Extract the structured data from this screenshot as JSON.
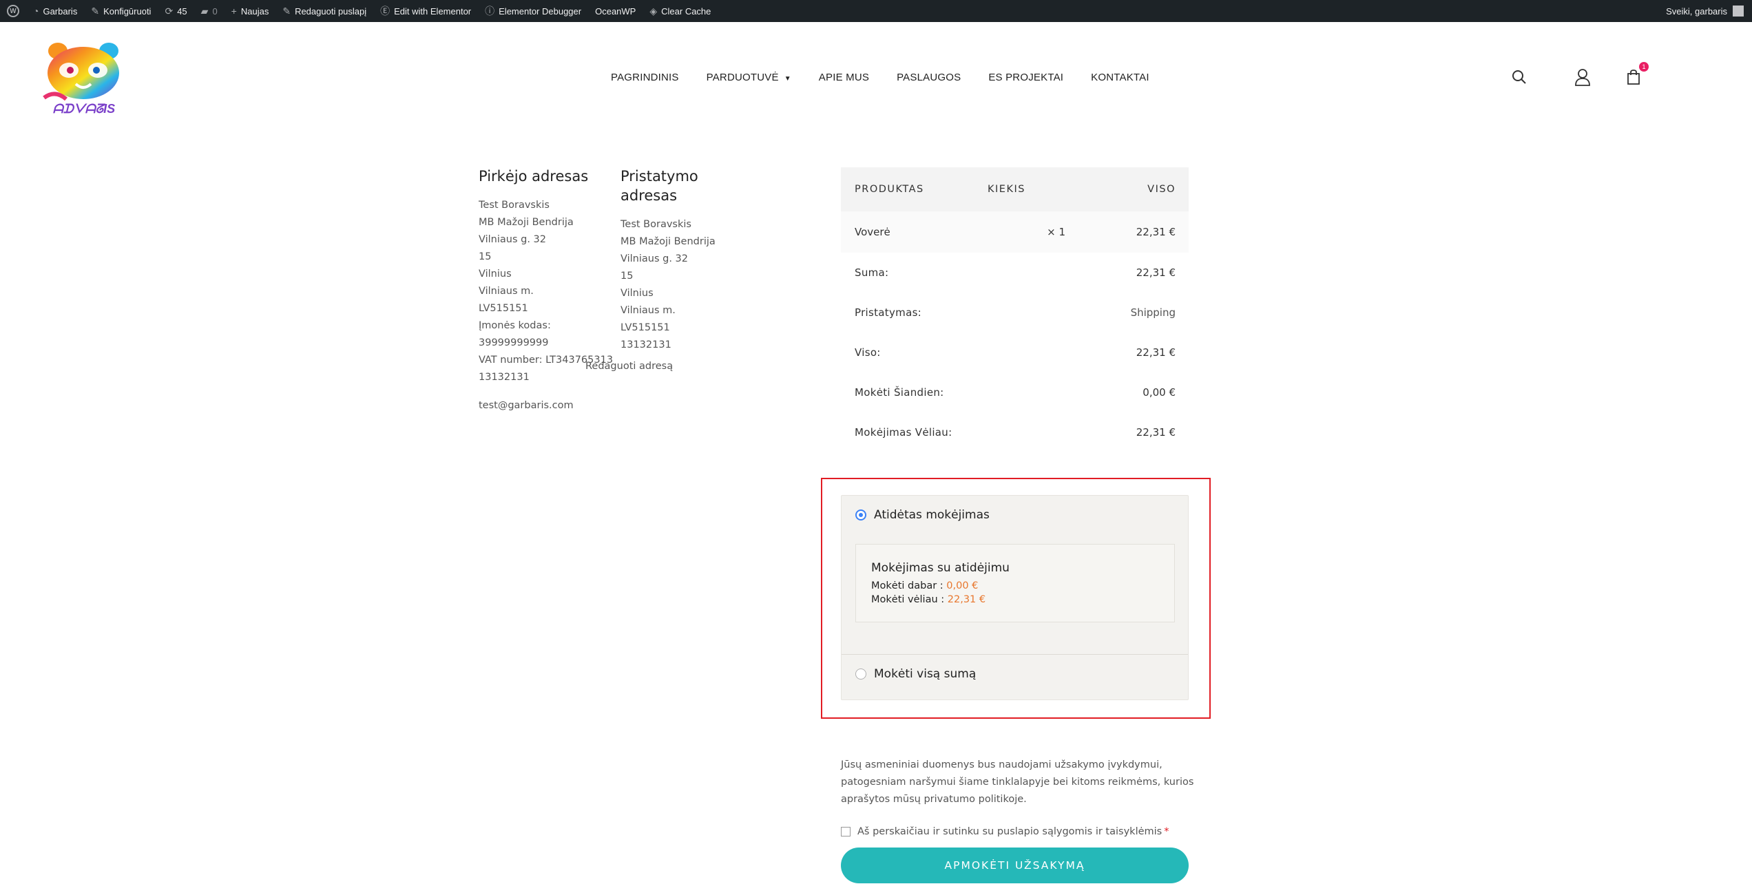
{
  "adminbar": {
    "site": "Garbaris",
    "customize": "Konfigūruoti",
    "updates": "45",
    "comments": "0",
    "new": "Naujas",
    "edit_page": "Redaguoti puslapį",
    "elementor": "Edit with Elementor",
    "debugger": "Elementor Debugger",
    "oceanwp": "OceanWP",
    "cache": "Clear Cache",
    "greeting": "Sveiki, garbaris"
  },
  "nav": {
    "items": [
      "PAGRINDINIS",
      "PARDUOTUVĖ",
      "APIE MUS",
      "PASLAUGOS",
      "ES PROJEKTAI",
      "KONTAKTAI"
    ]
  },
  "cart": {
    "count": "1"
  },
  "billing": {
    "title": "Pirkėjo adresas",
    "lines": [
      "Test Boravskis",
      "MB Mažoji Bendrija",
      "Vilniaus g. 32",
      "15",
      "Vilnius",
      "Vilniaus m.",
      "LV515151",
      "Įmonės kodas:",
      "39999999999",
      "VAT number: LT343765313",
      "13132131"
    ],
    "email": "test@garbaris.com"
  },
  "shipping": {
    "title_1": "Pristatymo",
    "title_2": "adresas",
    "lines": [
      "Test Boravskis",
      "MB Mažoji Bendrija",
      "Vilniaus g. 32",
      "15",
      "Vilnius",
      "Vilniaus m.",
      "LV515151",
      "13132131"
    ],
    "edit": "Redaguoti adresą"
  },
  "order": {
    "headers": [
      "PRODUKTAS",
      "KIEKIS",
      "VISO"
    ],
    "product": {
      "name": "Voverė",
      "qty": "× 1",
      "total": "22,31 €"
    },
    "rows": [
      {
        "label": "Suma:",
        "value": "22,31 €"
      },
      {
        "label": "Pristatymas:",
        "value": "Shipping"
      },
      {
        "label": "Viso:",
        "value": "22,31 €"
      },
      {
        "label": "Mokėti Šiandien:",
        "value": "0,00 €"
      },
      {
        "label": "Mokėjimas Vėliau:",
        "value": "22,31 €"
      }
    ]
  },
  "payment": {
    "deferred_label": "Atidėtas mokėjimas",
    "inner_title": "Mokėjimas su atidėjimu",
    "now_label": "Mokėti dabar : ",
    "now_amount": "0,00 €",
    "later_label": "Mokėti vėliau : ",
    "later_amount": "22,31 €",
    "full_label": "Mokėti visą sumą"
  },
  "privacy": {
    "text": "Jūsų asmeniniai duomenys bus naudojami užsakymo įvykdymui, patogesniam naršymui šiame tinklalapyje bei kitoms reikmėms, kurios aprašytos mūsų",
    "link": "privatumo politikoje",
    "end": "."
  },
  "terms": {
    "label": "Aš perskaičiau ir sutinku su puslapio sąlygomis ir taisyklėmis",
    "required": "*"
  },
  "submit": {
    "label": "APMOKĖTI UŽSAKYMĄ"
  },
  "colors": {
    "accent": "#25b8b8",
    "highlight": "#e11d24",
    "amount": "#e8772e",
    "radio": "#3b82f6"
  }
}
